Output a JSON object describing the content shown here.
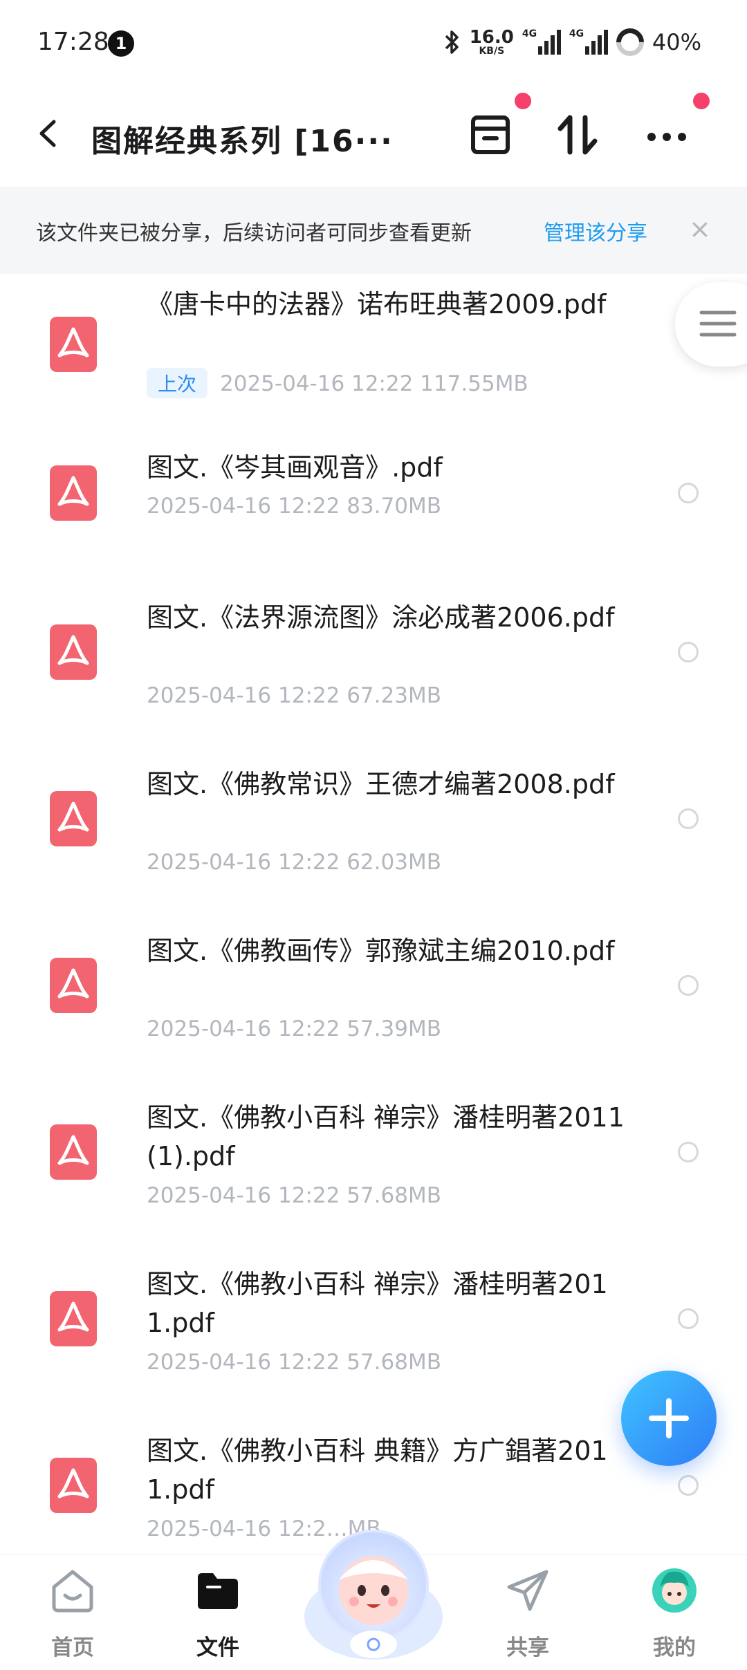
{
  "status_bar": {
    "time": "17:28",
    "notification_count": "1",
    "net_speed": "16.0",
    "net_speed_unit": "KB/S",
    "network_1": "4G",
    "network_2": "4G",
    "battery": "40%"
  },
  "header": {
    "title": "图解经典系列 [16···",
    "icons": [
      "back-icon",
      "archive-box-icon",
      "sort-icon",
      "more-icon"
    ]
  },
  "banner": {
    "text": "该文件夹已被分享，后续访问者可同步查看更新",
    "link": "管理该分享",
    "close": "×"
  },
  "files": [
    {
      "name": "《唐卡中的法器》诺布旺典著2009.pdf",
      "tag": "上次",
      "meta": "2025-04-16  12:22  117.55MB"
    },
    {
      "name": "图文.《岑其画观音》.pdf",
      "tag": "",
      "meta": "2025-04-16  12:22  83.70MB"
    },
    {
      "name": "图文.《法界源流图》涂必成著2006.pdf",
      "tag": "",
      "meta": "2025-04-16  12:22  67.23MB"
    },
    {
      "name": "图文.《佛教常识》王德才编著2008.pdf",
      "tag": "",
      "meta": "2025-04-16  12:22  62.03MB"
    },
    {
      "name": "图文.《佛教画传》郭豫斌主编2010.pdf",
      "tag": "",
      "meta": "2025-04-16  12:22  57.39MB"
    },
    {
      "name": "图文.《佛教小百科 禅宗》潘桂明著2011(1).pdf",
      "tag": "",
      "meta": "2025-04-16  12:22  57.68MB"
    },
    {
      "name": "图文.《佛教小百科 禅宗》潘桂明著2011.pdf",
      "tag": "",
      "meta": "2025-04-16  12:22  57.68MB"
    },
    {
      "name": "图文.《佛教小百科 典籍》方广錩著2011.pdf",
      "tag": "",
      "meta": "2025-04-16  12:2…MB"
    }
  ],
  "nav": {
    "items": [
      {
        "label": "首页",
        "icon": "home-icon"
      },
      {
        "label": "文件",
        "icon": "folder-icon"
      },
      {
        "label": "共享",
        "icon": "share-icon"
      },
      {
        "label": "我的",
        "icon": "avatar-icon"
      }
    ],
    "active": "文件"
  },
  "colors": {
    "accent": "#1f9bf0",
    "pdf": "#f2646f",
    "dot": "#f5406b"
  }
}
